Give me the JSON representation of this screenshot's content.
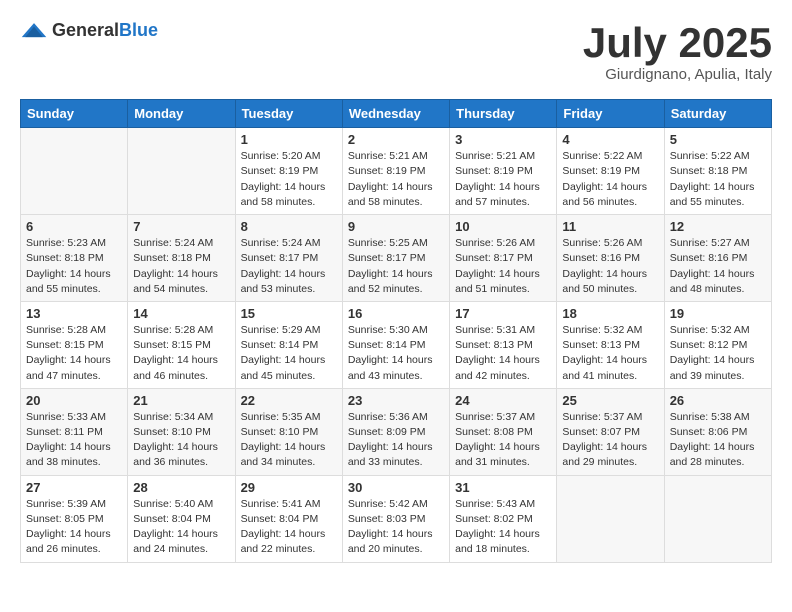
{
  "header": {
    "logo_general": "General",
    "logo_blue": "Blue",
    "month_title": "July 2025",
    "subtitle": "Giurdignano, Apulia, Italy"
  },
  "weekdays": [
    "Sunday",
    "Monday",
    "Tuesday",
    "Wednesday",
    "Thursday",
    "Friday",
    "Saturday"
  ],
  "weeks": [
    [
      {
        "day": "",
        "sunrise": "",
        "sunset": "",
        "daylight": ""
      },
      {
        "day": "",
        "sunrise": "",
        "sunset": "",
        "daylight": ""
      },
      {
        "day": "1",
        "sunrise": "Sunrise: 5:20 AM",
        "sunset": "Sunset: 8:19 PM",
        "daylight": "Daylight: 14 hours and 58 minutes."
      },
      {
        "day": "2",
        "sunrise": "Sunrise: 5:21 AM",
        "sunset": "Sunset: 8:19 PM",
        "daylight": "Daylight: 14 hours and 58 minutes."
      },
      {
        "day": "3",
        "sunrise": "Sunrise: 5:21 AM",
        "sunset": "Sunset: 8:19 PM",
        "daylight": "Daylight: 14 hours and 57 minutes."
      },
      {
        "day": "4",
        "sunrise": "Sunrise: 5:22 AM",
        "sunset": "Sunset: 8:19 PM",
        "daylight": "Daylight: 14 hours and 56 minutes."
      },
      {
        "day": "5",
        "sunrise": "Sunrise: 5:22 AM",
        "sunset": "Sunset: 8:18 PM",
        "daylight": "Daylight: 14 hours and 55 minutes."
      }
    ],
    [
      {
        "day": "6",
        "sunrise": "Sunrise: 5:23 AM",
        "sunset": "Sunset: 8:18 PM",
        "daylight": "Daylight: 14 hours and 55 minutes."
      },
      {
        "day": "7",
        "sunrise": "Sunrise: 5:24 AM",
        "sunset": "Sunset: 8:18 PM",
        "daylight": "Daylight: 14 hours and 54 minutes."
      },
      {
        "day": "8",
        "sunrise": "Sunrise: 5:24 AM",
        "sunset": "Sunset: 8:17 PM",
        "daylight": "Daylight: 14 hours and 53 minutes."
      },
      {
        "day": "9",
        "sunrise": "Sunrise: 5:25 AM",
        "sunset": "Sunset: 8:17 PM",
        "daylight": "Daylight: 14 hours and 52 minutes."
      },
      {
        "day": "10",
        "sunrise": "Sunrise: 5:26 AM",
        "sunset": "Sunset: 8:17 PM",
        "daylight": "Daylight: 14 hours and 51 minutes."
      },
      {
        "day": "11",
        "sunrise": "Sunrise: 5:26 AM",
        "sunset": "Sunset: 8:16 PM",
        "daylight": "Daylight: 14 hours and 50 minutes."
      },
      {
        "day": "12",
        "sunrise": "Sunrise: 5:27 AM",
        "sunset": "Sunset: 8:16 PM",
        "daylight": "Daylight: 14 hours and 48 minutes."
      }
    ],
    [
      {
        "day": "13",
        "sunrise": "Sunrise: 5:28 AM",
        "sunset": "Sunset: 8:15 PM",
        "daylight": "Daylight: 14 hours and 47 minutes."
      },
      {
        "day": "14",
        "sunrise": "Sunrise: 5:28 AM",
        "sunset": "Sunset: 8:15 PM",
        "daylight": "Daylight: 14 hours and 46 minutes."
      },
      {
        "day": "15",
        "sunrise": "Sunrise: 5:29 AM",
        "sunset": "Sunset: 8:14 PM",
        "daylight": "Daylight: 14 hours and 45 minutes."
      },
      {
        "day": "16",
        "sunrise": "Sunrise: 5:30 AM",
        "sunset": "Sunset: 8:14 PM",
        "daylight": "Daylight: 14 hours and 43 minutes."
      },
      {
        "day": "17",
        "sunrise": "Sunrise: 5:31 AM",
        "sunset": "Sunset: 8:13 PM",
        "daylight": "Daylight: 14 hours and 42 minutes."
      },
      {
        "day": "18",
        "sunrise": "Sunrise: 5:32 AM",
        "sunset": "Sunset: 8:13 PM",
        "daylight": "Daylight: 14 hours and 41 minutes."
      },
      {
        "day": "19",
        "sunrise": "Sunrise: 5:32 AM",
        "sunset": "Sunset: 8:12 PM",
        "daylight": "Daylight: 14 hours and 39 minutes."
      }
    ],
    [
      {
        "day": "20",
        "sunrise": "Sunrise: 5:33 AM",
        "sunset": "Sunset: 8:11 PM",
        "daylight": "Daylight: 14 hours and 38 minutes."
      },
      {
        "day": "21",
        "sunrise": "Sunrise: 5:34 AM",
        "sunset": "Sunset: 8:10 PM",
        "daylight": "Daylight: 14 hours and 36 minutes."
      },
      {
        "day": "22",
        "sunrise": "Sunrise: 5:35 AM",
        "sunset": "Sunset: 8:10 PM",
        "daylight": "Daylight: 14 hours and 34 minutes."
      },
      {
        "day": "23",
        "sunrise": "Sunrise: 5:36 AM",
        "sunset": "Sunset: 8:09 PM",
        "daylight": "Daylight: 14 hours and 33 minutes."
      },
      {
        "day": "24",
        "sunrise": "Sunrise: 5:37 AM",
        "sunset": "Sunset: 8:08 PM",
        "daylight": "Daylight: 14 hours and 31 minutes."
      },
      {
        "day": "25",
        "sunrise": "Sunrise: 5:37 AM",
        "sunset": "Sunset: 8:07 PM",
        "daylight": "Daylight: 14 hours and 29 minutes."
      },
      {
        "day": "26",
        "sunrise": "Sunrise: 5:38 AM",
        "sunset": "Sunset: 8:06 PM",
        "daylight": "Daylight: 14 hours and 28 minutes."
      }
    ],
    [
      {
        "day": "27",
        "sunrise": "Sunrise: 5:39 AM",
        "sunset": "Sunset: 8:05 PM",
        "daylight": "Daylight: 14 hours and 26 minutes."
      },
      {
        "day": "28",
        "sunrise": "Sunrise: 5:40 AM",
        "sunset": "Sunset: 8:04 PM",
        "daylight": "Daylight: 14 hours and 24 minutes."
      },
      {
        "day": "29",
        "sunrise": "Sunrise: 5:41 AM",
        "sunset": "Sunset: 8:04 PM",
        "daylight": "Daylight: 14 hours and 22 minutes."
      },
      {
        "day": "30",
        "sunrise": "Sunrise: 5:42 AM",
        "sunset": "Sunset: 8:03 PM",
        "daylight": "Daylight: 14 hours and 20 minutes."
      },
      {
        "day": "31",
        "sunrise": "Sunrise: 5:43 AM",
        "sunset": "Sunset: 8:02 PM",
        "daylight": "Daylight: 14 hours and 18 minutes."
      },
      {
        "day": "",
        "sunrise": "",
        "sunset": "",
        "daylight": ""
      },
      {
        "day": "",
        "sunrise": "",
        "sunset": "",
        "daylight": ""
      }
    ]
  ]
}
